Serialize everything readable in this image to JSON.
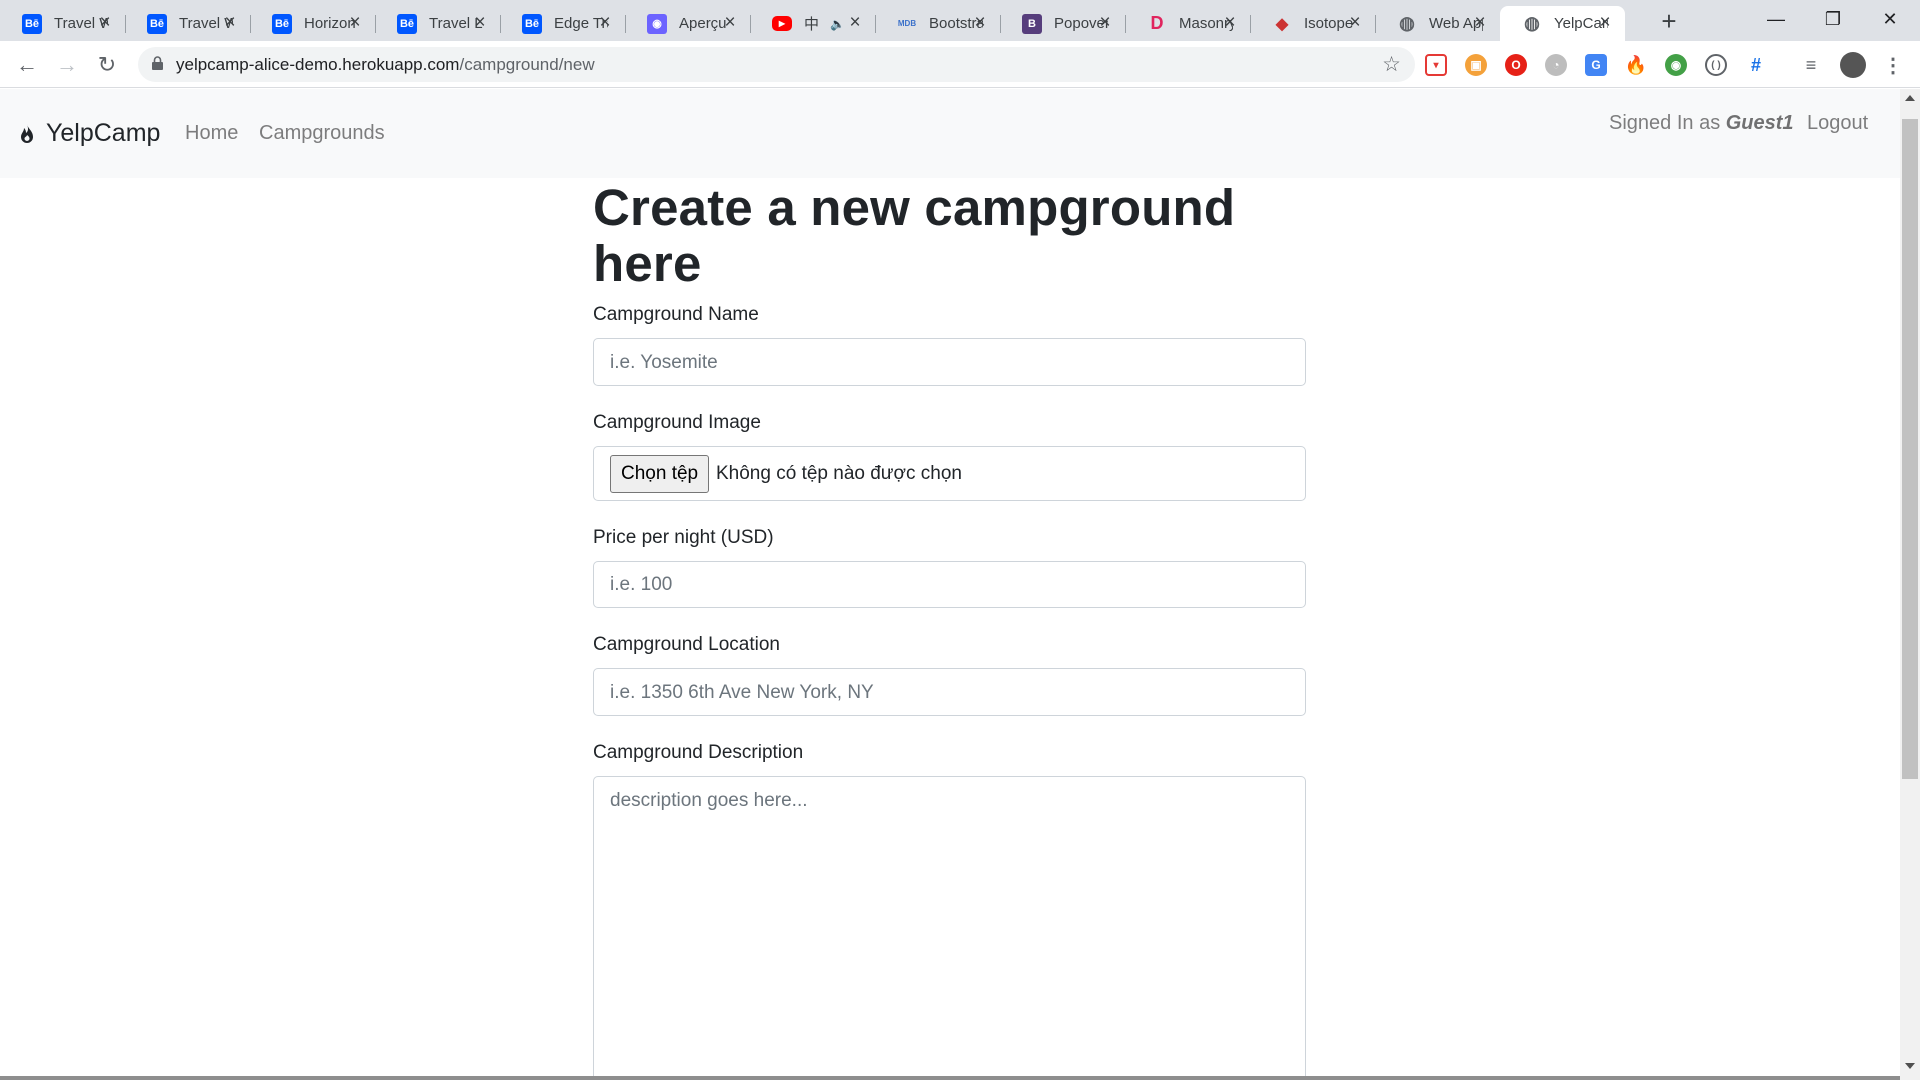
{
  "browser": {
    "tabs": [
      {
        "title": "Travel Website",
        "icon": "behance-icon",
        "color": "#0057ff",
        "glyph": "Bē"
      },
      {
        "title": "Travel Website",
        "icon": "behance-icon",
        "color": "#0057ff",
        "glyph": "Bē"
      },
      {
        "title": "Horizon",
        "icon": "behance-icon",
        "color": "#0057ff",
        "glyph": "Bē"
      },
      {
        "title": "Travel Landing",
        "icon": "behance-icon",
        "color": "#0057ff",
        "glyph": "Bē"
      },
      {
        "title": "Edge Travel",
        "icon": "behance-icon",
        "color": "#0057ff",
        "glyph": "Bē"
      },
      {
        "title": "Aperçu",
        "icon": "shield-icon",
        "color": "#6c63ff",
        "glyph": "◉"
      },
      {
        "title": "中",
        "icon": "youtube-icon",
        "color": "#ff0000",
        "glyph": "▶",
        "muted": true
      },
      {
        "title": "Bootstrap",
        "icon": "mdb-icon",
        "color": "#3b71ca",
        "glyph": "MDB"
      },
      {
        "title": "Popover",
        "icon": "bootstrap-icon",
        "color": "#563d7c",
        "glyph": "B"
      },
      {
        "title": "Masonry",
        "icon": "d-logo-icon",
        "color": "#e0245e",
        "glyph": "D"
      },
      {
        "title": "Isotope",
        "icon": "isotope-icon",
        "color": "#c33",
        "glyph": "◆"
      },
      {
        "title": "Web Application",
        "icon": "globe-icon",
        "color": "#5f6368",
        "glyph": "◍"
      },
      {
        "title": "YelpCamp",
        "icon": "globe-icon",
        "color": "#5f6368",
        "glyph": "◍",
        "active": true
      }
    ],
    "url_host": "yelpcamp-alice-demo.herokuapp.com",
    "url_path": "/campground/new"
  },
  "navbar": {
    "brand": "YelpCamp",
    "links": [
      "Home",
      "Campgrounds"
    ],
    "signed_in_prefix": "Signed In as ",
    "username": "Guest1",
    "logout": "Logout"
  },
  "form": {
    "heading": "Create a new campground here",
    "name_label": "Campground Name",
    "name_placeholder": "i.e. Yosemite",
    "image_label": "Campground Image",
    "file_button": "Chọn tệp",
    "file_status": "Không có tệp nào được chọn",
    "price_label": "Price per night (USD)",
    "price_placeholder": "i.e. 100",
    "location_label": "Campground Location",
    "location_placeholder": "i.e. 1350 6th Ave New York, NY",
    "description_label": "Campground Description",
    "description_placeholder": "description goes here..."
  }
}
